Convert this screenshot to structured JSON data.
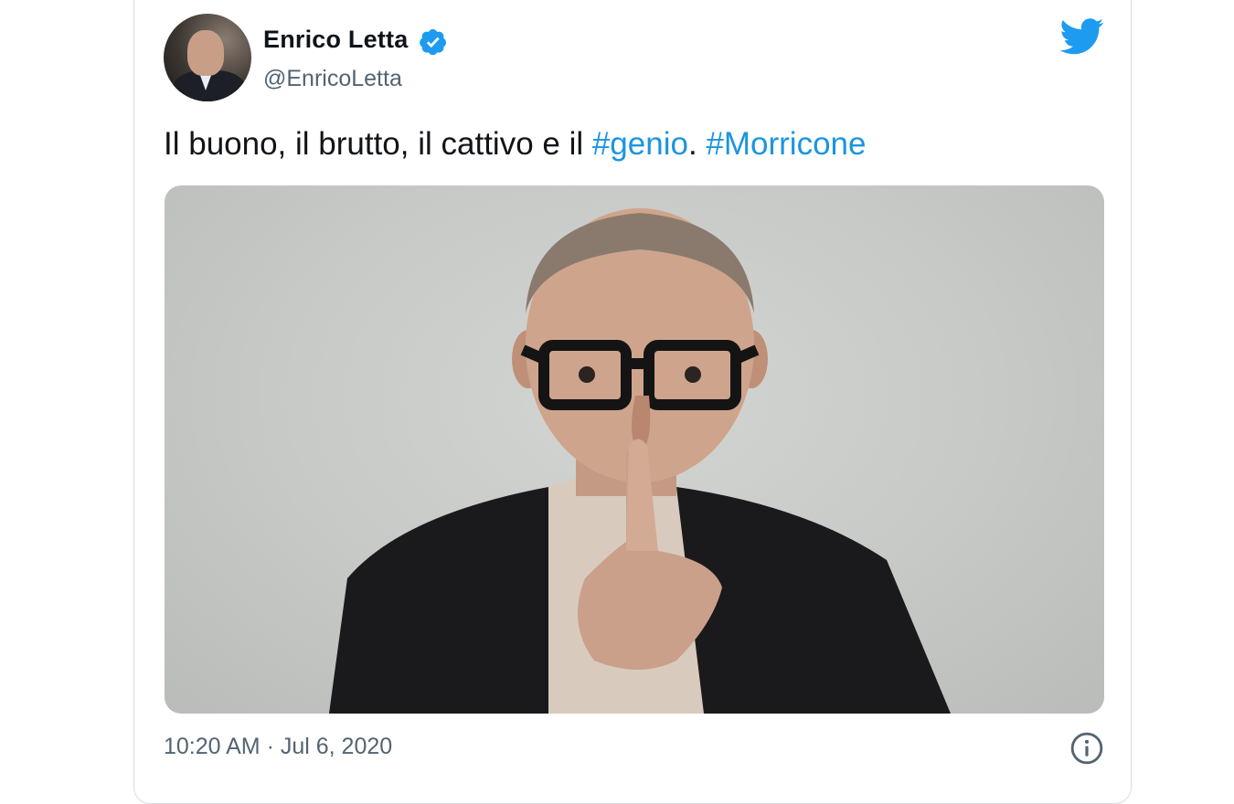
{
  "author": {
    "display_name": "Enrico Letta",
    "handle": "@EnricoLetta",
    "verified": true,
    "avatar_icon": "profile-photo"
  },
  "tweet": {
    "text_plain": "Il buono, il brutto, il cattivo e il ",
    "hashtag_1": "#genio",
    "separator": ". ",
    "hashtag_2": "#Morricone",
    "media_description": "photo-of-man-with-finger-on-lips"
  },
  "meta": {
    "time": "10:20 AM",
    "dot": " · ",
    "date": "Jul 6, 2020"
  },
  "icons": {
    "brand": "twitter-bird-icon",
    "verified": "verified-badge-icon",
    "info": "info-icon"
  },
  "colors": {
    "brand_blue": "#1d9bf0",
    "hashtag_blue": "#1b95e0",
    "text": "#0f1419",
    "secondary_text": "#536471"
  }
}
